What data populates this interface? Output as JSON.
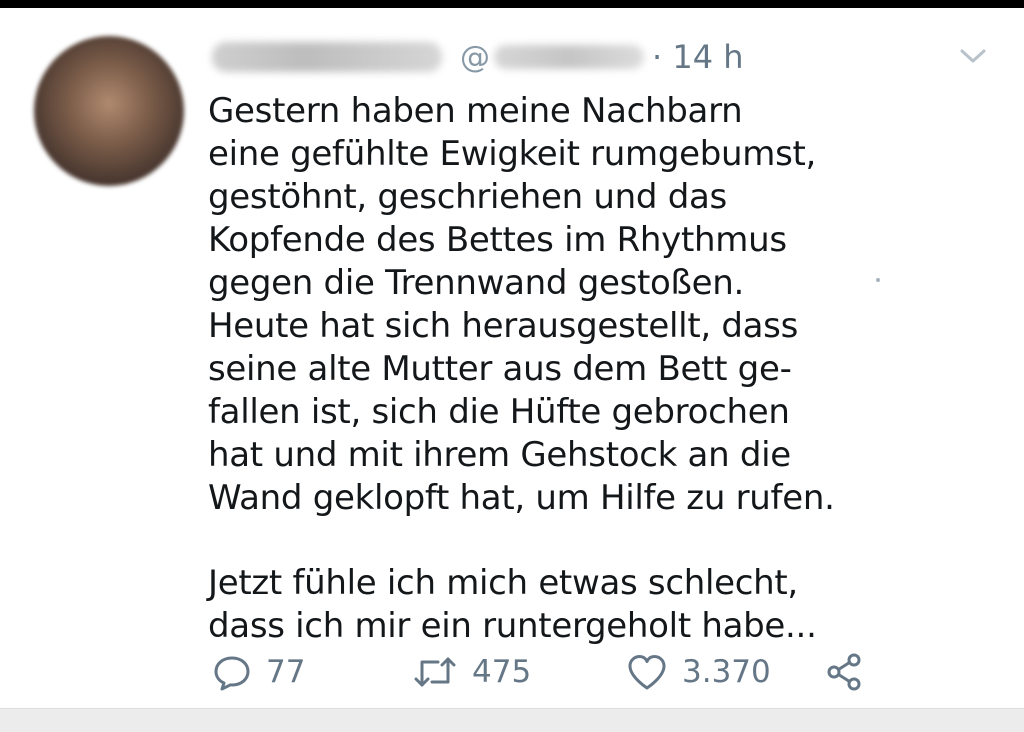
{
  "tweet": {
    "handle_prefix": "@",
    "time": "· 14 h",
    "text_lines": [
      "Gestern haben meine Nachbarn",
      "eine gefühlte Ewigkeit rumgebumst,",
      "gestöhnt, geschriehen und das",
      "Kopfende des Bettes im Rhythmus",
      "gegen die Trennwand gestoßen.",
      "Heute hat sich herausgestellt, dass",
      "seine alte Mutter aus dem Bett ge-",
      "fallen ist, sich die Hüfte gebrochen",
      "hat und mit ihrem Gehstock an die",
      "Wand geklopft hat, um Hilfe zu rufen."
    ],
    "text_lines_2": [
      "Jetzt fühle ich mich etwas schlecht,",
      "dass ich mir ein runtergeholt habe..."
    ],
    "actions": {
      "replies": "77",
      "retweets": "475",
      "likes": "3.370"
    }
  },
  "icons": {
    "caret": "chevron-down-icon",
    "reply": "reply-icon",
    "retweet": "retweet-icon",
    "like": "heart-icon",
    "share": "share-icon"
  },
  "colors": {
    "text": "#14171a",
    "muted": "#657786",
    "top_bar": "#000000"
  }
}
